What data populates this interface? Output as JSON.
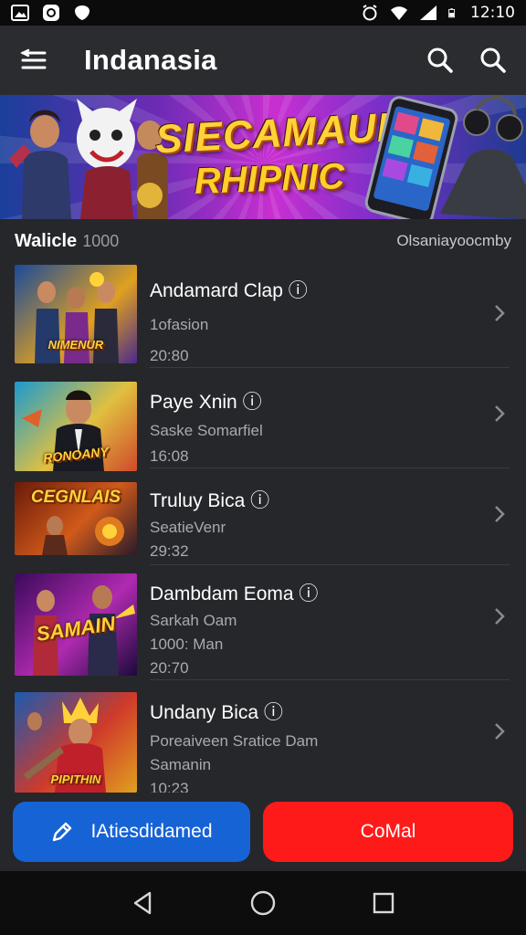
{
  "status_bar": {
    "time": "12:10"
  },
  "app_bar": {
    "title": "Indanasia"
  },
  "banner": {
    "line1": "SIECAMAUK",
    "line2": "RHIPNIC"
  },
  "section": {
    "title": "Walicle",
    "count": "1000",
    "link": "Olsaniayoocmby"
  },
  "items": [
    {
      "title": "Andamard Clap ⓘ",
      "subtitle": "1ofasion",
      "time": "20:80",
      "thumb_label": "NIMENUR"
    },
    {
      "title": "Paye Xnin ⓘ",
      "subtitle": "Saske Somarfiel",
      "time": "16:08",
      "thumb_label": "RONOANY"
    },
    {
      "title": "Truluy Bica ⓘ",
      "subtitle": "SeatieVenr",
      "time": "29:32",
      "thumb_label": "CEGNLAIS"
    },
    {
      "title": "Dambdam Eoma ⓘ",
      "subtitle": "Sarkah Oam",
      "extra": "1000: Man",
      "time": "20:70",
      "thumb_label": "SAMAIN"
    },
    {
      "title": "Undany Bica ⓘ",
      "subtitle": "Poreaiveen Sratice Dam",
      "extra": "Samanin",
      "time": "10:23",
      "thumb_label": "PIPITHIN"
    }
  ],
  "actions": {
    "primary_label": "IAtiesdidamed",
    "danger_label": "CoMal"
  },
  "colors": {
    "primary": "#1663d6",
    "danger": "#ff1a1a",
    "background": "#26272b",
    "banner_accent": "#c92fd1"
  }
}
